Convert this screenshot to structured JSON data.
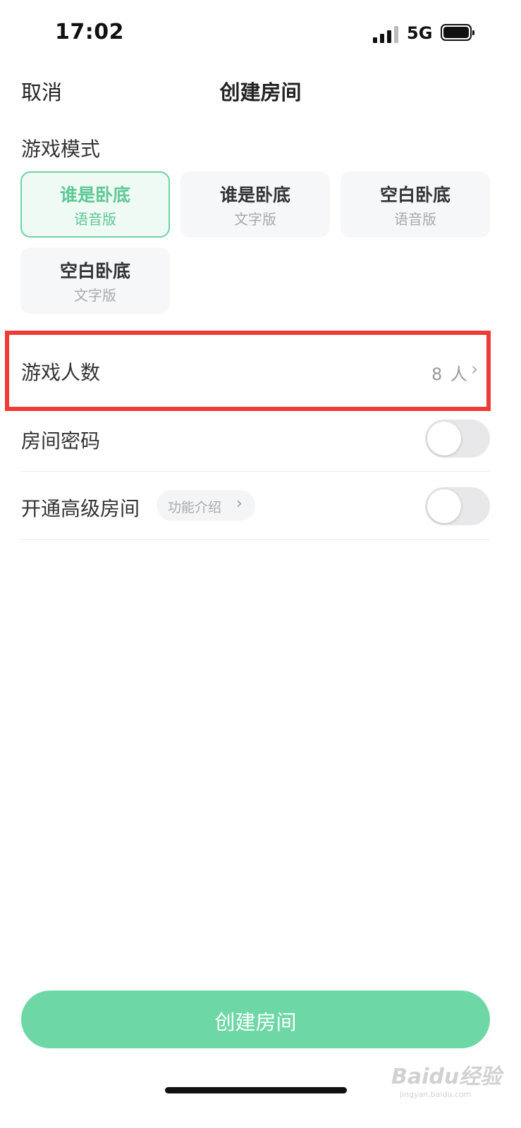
{
  "status_bar": {
    "time": "17:02",
    "network": "5G"
  },
  "nav": {
    "cancel_label": "取消",
    "title": "创建房间"
  },
  "game_mode": {
    "title": "游戏模式",
    "options": [
      {
        "name": "谁是卧底",
        "sub": "语音版",
        "selected": true
      },
      {
        "name": "谁是卧底",
        "sub": "文字版",
        "selected": false
      },
      {
        "name": "空白卧底",
        "sub": "语音版",
        "selected": false
      },
      {
        "name": "空白卧底",
        "sub": "文字版",
        "selected": false
      }
    ]
  },
  "player_count": {
    "label": "游戏人数",
    "value": "8 人"
  },
  "room_password": {
    "label": "房间密码",
    "enabled": false
  },
  "premium_room": {
    "label": "开通高级房间",
    "feature_tag": "功能介绍",
    "enabled": false
  },
  "create_button": {
    "label": "创建房间"
  },
  "watermark": {
    "text": "Baidu经验",
    "sub": "jingyan.baidu.com"
  },
  "colors": {
    "accent": "#6dd8a6",
    "accent_text": "#5fc895",
    "highlight_border": "#ee3b33",
    "toggle_off": "#e8e8ea"
  }
}
